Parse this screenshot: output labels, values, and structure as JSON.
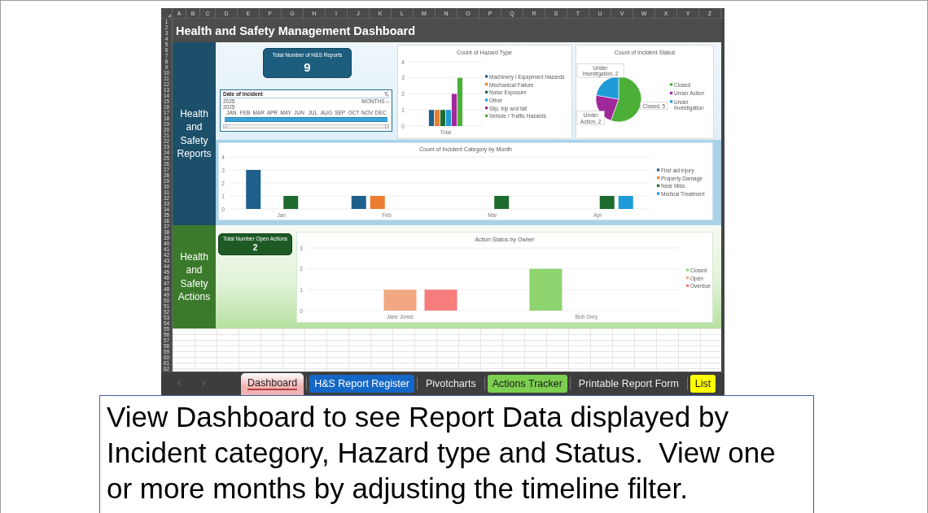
{
  "spreadsheet": {
    "column_headers": [
      "A",
      "B",
      "C",
      "D",
      "E",
      "F",
      "G",
      "H",
      "I",
      "J",
      "K",
      "L",
      "M",
      "N",
      "O",
      "P",
      "Q",
      "R",
      "S",
      "T",
      "U",
      "V",
      "W",
      "X",
      "Y",
      "Z"
    ],
    "row_numbers": [
      "1",
      "2",
      "3",
      "4",
      "5",
      "6",
      "7",
      "8",
      "9",
      "10",
      "11",
      "12",
      "13",
      "14",
      "15",
      "16",
      "17",
      "18",
      "19",
      "20",
      "21",
      "22",
      "23",
      "24",
      "25",
      "26",
      "27",
      "28",
      "29",
      "30",
      "31",
      "32",
      "33",
      "34",
      "35",
      "36",
      "37",
      "38",
      "39",
      "40",
      "41",
      "42",
      "43",
      "44",
      "45",
      "46",
      "47",
      "48",
      "49",
      "50",
      "51",
      "52",
      "53",
      "54",
      "55",
      "56",
      "57",
      "58",
      "59",
      "60",
      "61",
      "62"
    ],
    "title": "Health and Safety Management Dashboard",
    "reports_section": {
      "label": "Health and Safety Reports",
      "kpi": {
        "label": "Total Number of H&S Reports",
        "value": "9"
      },
      "timeline": {
        "title": "Date of Incident",
        "range_label": "2025",
        "period_selector": "MONTHS",
        "year": "2025",
        "months": [
          {
            "label": "JAN",
            "selected": true
          },
          {
            "label": "FEB",
            "selected": true
          },
          {
            "label": "MAR",
            "selected": true
          },
          {
            "label": "APR",
            "selected": true
          },
          {
            "label": "MAY",
            "selected": true
          },
          {
            "label": "JUN",
            "selected": true
          },
          {
            "label": "JUL",
            "selected": true
          },
          {
            "label": "AUG",
            "selected": true
          },
          {
            "label": "SEP",
            "selected": true
          },
          {
            "label": "OCT",
            "selected": true
          },
          {
            "label": "NOV",
            "selected": true
          },
          {
            "label": "DEC",
            "selected": true
          }
        ]
      },
      "hazard_type_chart": {
        "chart_data": {
          "type": "bar",
          "title": "Count of Hazard Type",
          "categories": [
            "Total"
          ],
          "series": [
            {
              "name": "Machinery / Equipment Hazards",
              "color": "#1f5f8b",
              "values": [
                1
              ]
            },
            {
              "name": "Mechanical Failure",
              "color": "#ed7d31",
              "values": [
                1
              ]
            },
            {
              "name": "Noise Exposure",
              "color": "#1e6b2f",
              "values": [
                1
              ]
            },
            {
              "name": "Other",
              "color": "#1e9bd7",
              "values": [
                1
              ]
            },
            {
              "name": "Slip, trip and fall",
              "color": "#a0289a",
              "values": [
                2
              ]
            },
            {
              "name": "Vehicle / Traffic Hazards",
              "color": "#4caf37",
              "values": [
                3
              ]
            }
          ],
          "ylim": [
            0,
            4
          ],
          "yticks": [
            0,
            1,
            2,
            3,
            4
          ],
          "grid": true,
          "legend": "right"
        }
      },
      "incident_status_chart": {
        "chart_data": {
          "type": "pie",
          "title": "Count of Incident Status",
          "categories": [
            "Closed",
            "Under Action",
            "Under Investigation"
          ],
          "values": [
            5,
            2,
            2
          ],
          "colors": [
            "#4caf37",
            "#a0289a",
            "#1e9bd7"
          ],
          "value_labels": [
            "Closed, 5",
            "Under Action, 2",
            "Under Investigation, 2"
          ],
          "legend": "right"
        }
      },
      "category_by_month_chart": {
        "chart_data": {
          "type": "bar",
          "title": "Count of Incident Category by Month",
          "categories": [
            "Jan",
            "Feb",
            "Mar",
            "Apr"
          ],
          "series": [
            {
              "name": "First aid injury",
              "color": "#1f5f8b",
              "values": [
                3,
                1,
                0,
                0
              ]
            },
            {
              "name": "Property Damage",
              "color": "#ed7d31",
              "values": [
                0,
                1,
                0,
                0
              ]
            },
            {
              "name": "Near Miss",
              "color": "#1e6b2f",
              "values": [
                1,
                0,
                1,
                1
              ]
            },
            {
              "name": "Medical Treatment",
              "color": "#1e9bd7",
              "values": [
                0,
                0,
                0,
                1
              ]
            }
          ],
          "ylim": [
            0,
            4
          ],
          "yticks": [
            0,
            1,
            2,
            3,
            4
          ],
          "grid": true,
          "legend": "right"
        }
      }
    },
    "actions_section": {
      "label": "Health and Safety Actions",
      "kpi": {
        "label": "Total Number Open Actions",
        "value": "2"
      },
      "action_status_chart": {
        "chart_data": {
          "type": "bar",
          "title": "Action Status by Owner",
          "categories": [
            "Jane Jones",
            "Bob Grey"
          ],
          "series": [
            {
              "name": "Closed",
              "color": "#8fd46f",
              "values": [
                0,
                2
              ]
            },
            {
              "name": "Open",
              "color": "#f1a883",
              "values": [
                1,
                0
              ]
            },
            {
              "name": "Overdue",
              "color": "#f77d7d",
              "values": [
                1,
                0
              ]
            }
          ],
          "ylim": [
            0,
            3
          ],
          "yticks": [
            0,
            1,
            2,
            3
          ],
          "grid": true,
          "legend": "right"
        }
      }
    },
    "sheet_tabs": [
      {
        "label": "Dashboard",
        "selected": true,
        "color": "#f2b3b3"
      },
      {
        "label": "H&S Report Register",
        "selected": false,
        "color": "#1467c6"
      },
      {
        "label": "Pivotcharts",
        "selected": false
      },
      {
        "label": "Actions Tracker",
        "selected": false,
        "color": "#7ccf4f"
      },
      {
        "label": "Printable Report Form",
        "selected": false
      },
      {
        "label": "List",
        "selected": false,
        "color": "#ffff00"
      }
    ]
  },
  "caption": "View Dashboard to see Report Data displayed by Incident category, Hazard type and Status.  View one or more months by adjusting the timeline filter."
}
